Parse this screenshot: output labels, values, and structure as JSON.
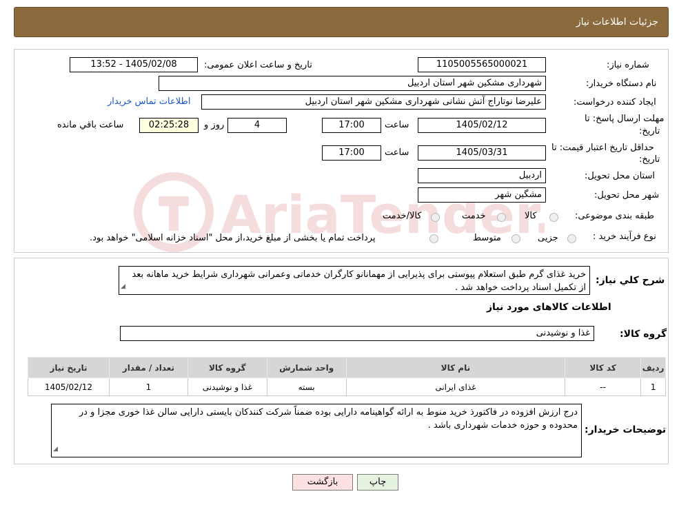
{
  "header": {
    "title": "جزئیات اطلاعات نیاز"
  },
  "fields": {
    "need_number_label": "شماره نیاز:",
    "need_number": "1105005565000021",
    "announce_label": "تاریخ و ساعت اعلان عمومی:",
    "announce_value": "1405/02/08 - 13:52",
    "buyer_org_label": "نام دستگاه خریدار:",
    "buyer_org": "شهرداری مشکین شهر استان اردبیل",
    "requester_label": "ایجاد کننده درخواست:",
    "requester": "علیرضا نوتاراج آتش نشانی شهرداری مشکین شهر استان اردبیل",
    "contact_link": "اطلاعات تماس خریدار",
    "deadline_label_1": "مهلت ارسال پاسخ: تا",
    "deadline_label_2": "تاریخ:",
    "deadline_date": "1405/02/12",
    "hour_label": "ساعت",
    "deadline_time": "17:00",
    "days_value": "4",
    "days_label": "روز و",
    "remaining_time": "02:25:28",
    "remaining_label": "ساعت باقي مانده",
    "validity_label_1": "حداقل تاریخ اعتبار قیمت: تا",
    "validity_label_2": "تاریخ:",
    "validity_date": "1405/03/31",
    "validity_hour_label": "ساعت",
    "validity_time": "17:00",
    "province_label": "استان محل تحویل:",
    "province": "اردبیل",
    "city_label": "شهر محل تحویل:",
    "city": "مشگین شهر",
    "category_label": "طبقه بندی موضوعی:",
    "category_options": [
      "کالا",
      "خدمت",
      "کالا/خدمت"
    ],
    "purchase_label": "نوع فرآیند خرید :",
    "purchase_options": [
      "جزیی",
      "متوسط"
    ],
    "purchase_note": "پرداخت تمام یا بخشی از مبلغ خرید،از محل \"اسناد خزانه اسلامی\" خواهد بود."
  },
  "watermark": {
    "text": "AriaTender.neT"
  },
  "description": {
    "label": "شرح کلي نياز:",
    "text": "خرید غذای گرم طبق استعلام پیوستی برای پذیرایی از مهمانانو کارگران خدماتی وعمرانی شهرداری  شرایط خرید ماهانه بعد از تکمیل اسناد پرداخت خواهد شد ."
  },
  "goods_section": {
    "title": "اطلاعات کالاهای مورد نیاز",
    "group_label": "گروه کالا:",
    "group_value": "غذا و نوشیدنی"
  },
  "table": {
    "headers": [
      "ردیف",
      "کد کالا",
      "نام کالا",
      "واحد شمارش",
      "گروه کالا",
      "تعداد / مقدار",
      "تاریخ نیاز"
    ],
    "rows": [
      [
        "1",
        "--",
        "غذای ایرانی",
        "بسته",
        "غذا و نوشیدنی",
        "1",
        "1405/02/12"
      ]
    ]
  },
  "buyer_notes": {
    "label": "توضیحات خریدار:",
    "text": "درج ارزش افزوده در فاکتورذ خرید منوط به ارائه گواهینامه دارایی بوده ضمناً شرکت کنندکان بایستی دارایی سالن غذا خوری مجزا و در محدوده و حوزه خدمات شهرداری باشد ."
  },
  "buttons": {
    "print": "چاپ",
    "back": "بازگشت"
  }
}
